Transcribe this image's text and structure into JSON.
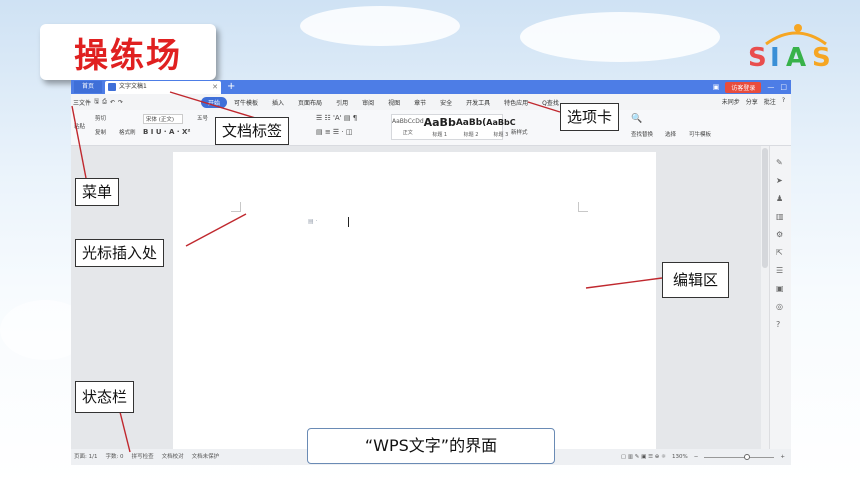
{
  "slide": {
    "title": "操练场",
    "caption": "“WPS文字”的界面"
  },
  "logo": {
    "text": "SIAS",
    "colors": [
      "#e94e4e",
      "#f6a623",
      "#38b24a",
      "#3a8fd6"
    ]
  },
  "callouts": {
    "doc_tab": "文档标签",
    "ribbon_tabs": "选项卡",
    "menu": "菜单",
    "cursor": "光标插入处",
    "edit_area": "编辑区",
    "status_bar": "状态栏"
  },
  "app": {
    "tabbar": {
      "home_tab": "首页",
      "doc_tab": "文字文稿1",
      "add": "+",
      "login": "访客登录",
      "accent": "#4d7de6"
    },
    "menubar": {
      "file": "三文件",
      "tabs": [
        "开始",
        "可牛模板",
        "插入",
        "页面布局",
        "引用",
        "审阅",
        "视图",
        "章节",
        "安全",
        "开发工具",
        "特色应用",
        "Q查找"
      ],
      "active_tab": "开始",
      "right": [
        "未同步",
        "分享",
        "批注",
        "?"
      ]
    },
    "ribbon": {
      "paste": "粘贴",
      "cut": "剪切",
      "copy": "复制",
      "format_painter": "格式刷",
      "font": "宋体 (正文)",
      "font_size": "五号",
      "styles": [
        {
          "preview": "AaBbCcDd",
          "name": "正文"
        },
        {
          "preview": "AaBb",
          "name": "标题 1"
        },
        {
          "preview": "AaBb(",
          "name": "标题 2"
        },
        {
          "preview": "AaBbC",
          "name": "标题 3"
        }
      ],
      "new_style": "新样式",
      "find_replace": "查找替换",
      "select": "选择",
      "template": "可牛模板"
    },
    "status": {
      "page": "页面: 1/1",
      "words": "字数: 0",
      "spell": "拼写检查",
      "proof": "文档校对",
      "protect": "文档未保护",
      "zoom": "130%"
    }
  }
}
